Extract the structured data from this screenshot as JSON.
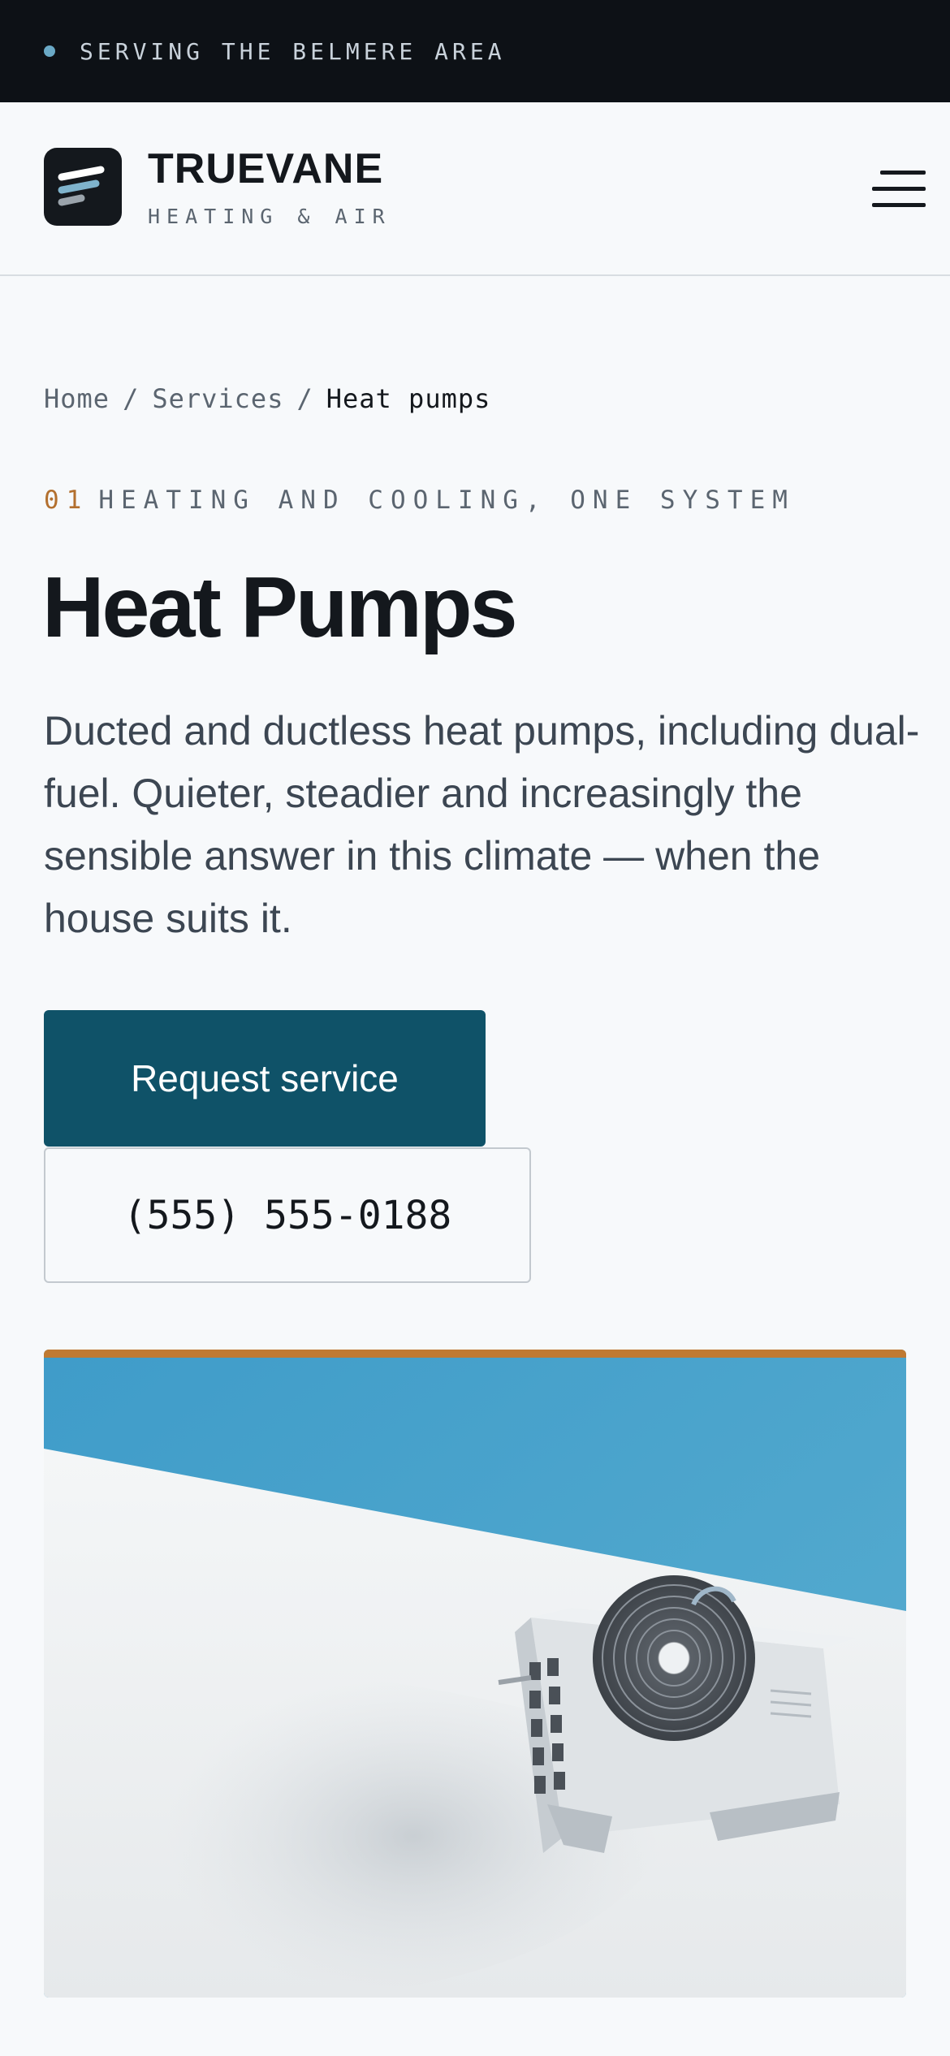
{
  "topbar": {
    "text": "SERVING THE BELMERE AREA"
  },
  "brand": {
    "name": "TRUEVANE",
    "tagline": "HEATING & AIR"
  },
  "header": {
    "menu_icon": "hamburger-menu-icon"
  },
  "breadcrumb": {
    "home": "Home",
    "services": "Services",
    "current": "Heat pumps",
    "separator": "/"
  },
  "eyebrow": {
    "number": "01",
    "text": "HEATING AND COOLING, ONE SYSTEM"
  },
  "page": {
    "title": "Heat Pumps",
    "lead": "Ducted and ductless heat pumps, including dual-fuel. Quieter, steadier and increasingly the sensible answer in this climate — when the house suits it."
  },
  "cta": {
    "primary_label": "Request service",
    "phone": "(555) 555-0188"
  },
  "colors": {
    "primary": "#0f5268",
    "accent": "#c07a32",
    "dark": "#0d1116",
    "eyebrow_number": "#b3702f"
  }
}
